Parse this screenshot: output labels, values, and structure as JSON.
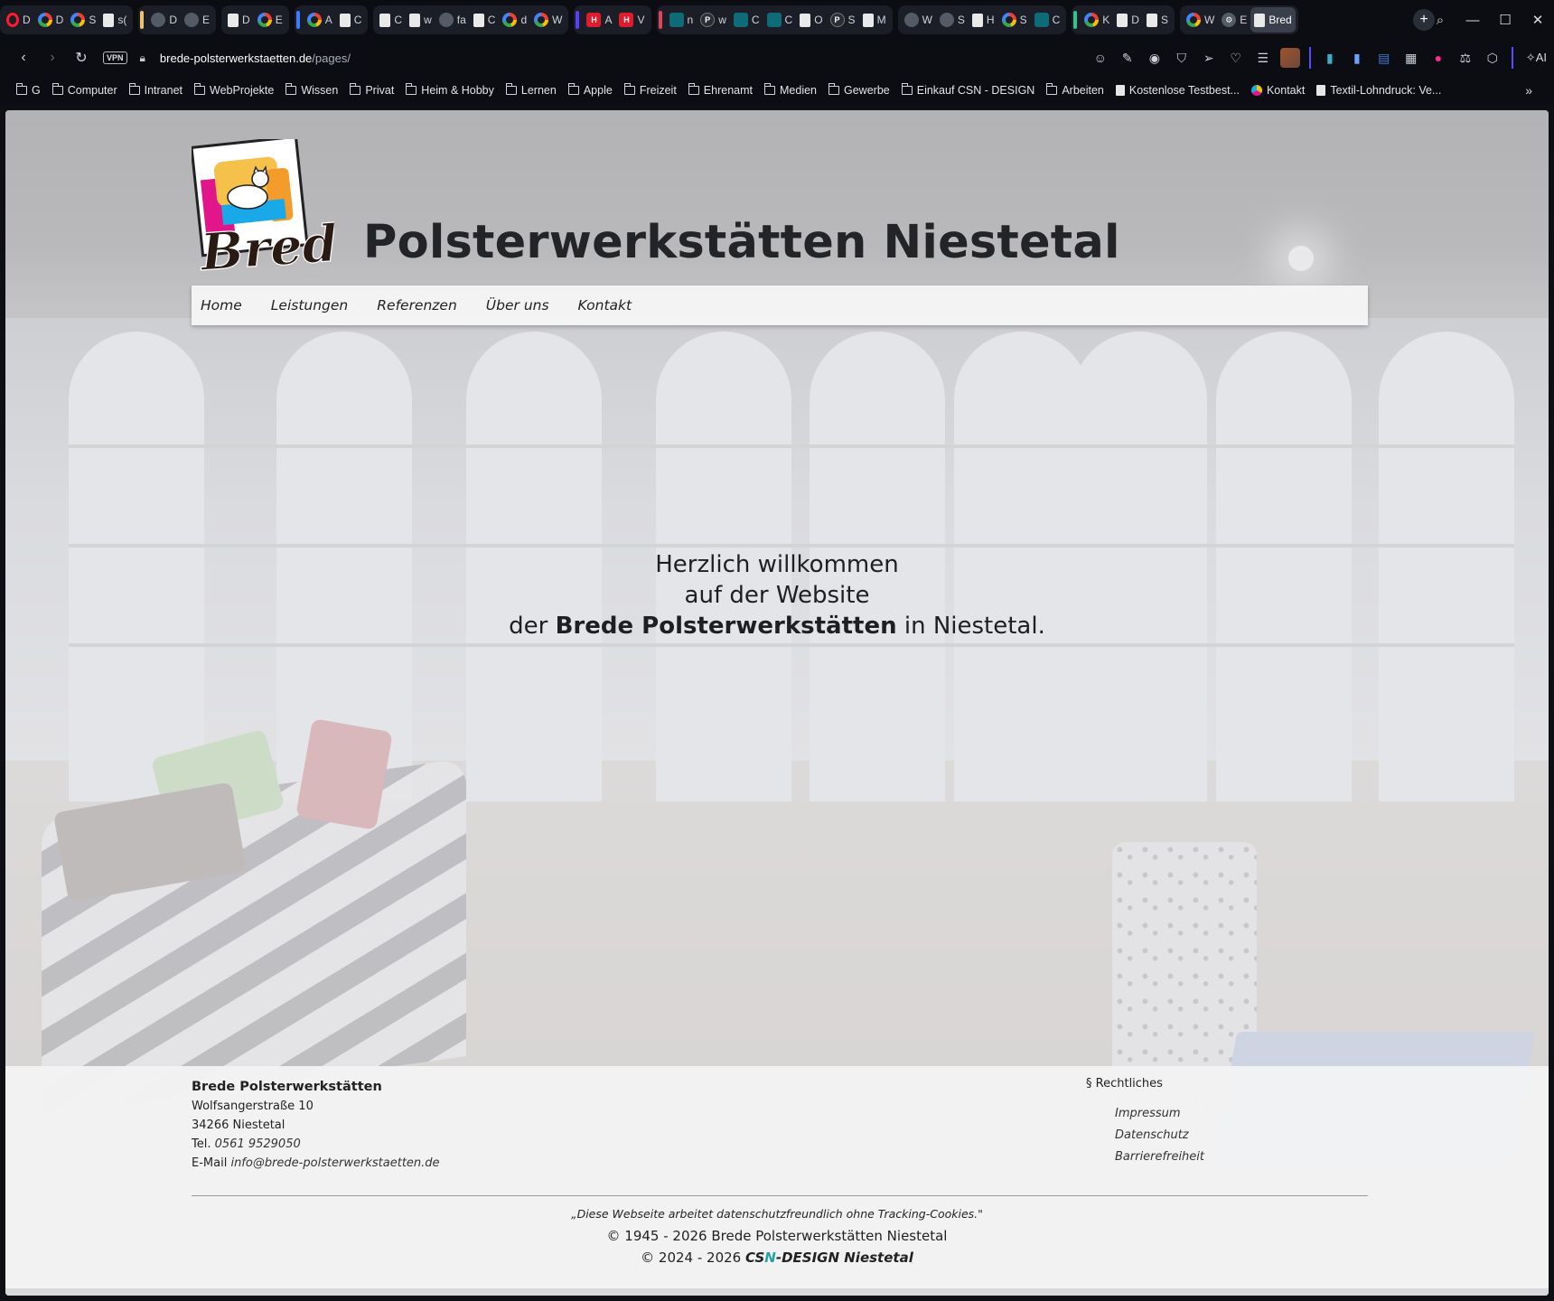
{
  "browser": {
    "tabs": [
      {
        "group_color": "",
        "items": [
          {
            "icon": "opera-icon",
            "label": "D"
          },
          {
            "icon": "google",
            "label": "D"
          },
          {
            "icon": "google",
            "label": "S"
          },
          {
            "icon": "doc",
            "label": "s("
          }
        ]
      },
      {
        "group_color": "#f0c36a",
        "items": [
          {
            "icon": "sun",
            "label": "D"
          },
          {
            "icon": "sun",
            "label": "E"
          }
        ]
      },
      {
        "group_color": "",
        "items": [
          {
            "icon": "doc",
            "label": "D"
          },
          {
            "icon": "google",
            "label": "E"
          }
        ]
      },
      {
        "group_color": "#3d7bff",
        "items": [
          {
            "icon": "google",
            "label": "A"
          },
          {
            "icon": "doc",
            "label": "C"
          }
        ]
      },
      {
        "group_color": "",
        "items": [
          {
            "icon": "doc",
            "label": "C"
          },
          {
            "icon": "doc",
            "label": "w"
          },
          {
            "icon": "grey",
            "label": "fa"
          },
          {
            "icon": "doc",
            "label": "C"
          },
          {
            "icon": "google",
            "label": "d"
          },
          {
            "icon": "google",
            "label": "W"
          }
        ]
      },
      {
        "group_color": "#5b3dff",
        "items": [
          {
            "icon": "red",
            "label": "A"
          },
          {
            "icon": "red",
            "label": "V"
          }
        ]
      },
      {
        "group_color": "#e0445a",
        "items": [
          {
            "icon": "teal",
            "label": "n"
          },
          {
            "icon": "dark",
            "label": "w"
          },
          {
            "icon": "teal",
            "label": "C"
          },
          {
            "icon": "teal",
            "label": "C"
          },
          {
            "icon": "doc",
            "label": "O"
          },
          {
            "icon": "dark",
            "label": "S"
          },
          {
            "icon": "doc",
            "label": "M"
          }
        ]
      },
      {
        "group_color": "",
        "items": [
          {
            "icon": "grey",
            "label": "W"
          },
          {
            "icon": "grey",
            "label": "S"
          },
          {
            "icon": "doc",
            "label": "H"
          },
          {
            "icon": "google",
            "label": "S"
          },
          {
            "icon": "teal",
            "label": "C"
          }
        ]
      },
      {
        "group_color": "#34c38f",
        "items": [
          {
            "icon": "google",
            "label": "K"
          },
          {
            "icon": "doc",
            "label": "D"
          },
          {
            "icon": "doc",
            "label": "S"
          }
        ]
      },
      {
        "group_color": "",
        "items": [
          {
            "icon": "google",
            "label": "W"
          },
          {
            "icon": "gear",
            "label": "E"
          },
          {
            "icon": "doc",
            "label": "Bred",
            "active": true
          }
        ]
      }
    ],
    "url_host": "brede-polsterwerkstaetten.de",
    "url_path": "/pages/",
    "vpn_label": "VPN",
    "ai_label": "AI",
    "bookmarks": [
      {
        "type": "folder",
        "label": "G"
      },
      {
        "type": "folder",
        "label": "Computer"
      },
      {
        "type": "folder",
        "label": "Intranet"
      },
      {
        "type": "folder",
        "label": "WebProjekte"
      },
      {
        "type": "folder",
        "label": "Wissen"
      },
      {
        "type": "folder",
        "label": "Privat"
      },
      {
        "type": "folder",
        "label": "Heim & Hobby"
      },
      {
        "type": "folder",
        "label": "Lernen"
      },
      {
        "type": "folder",
        "label": "Apple"
      },
      {
        "type": "folder",
        "label": "Freizeit"
      },
      {
        "type": "folder",
        "label": "Ehrenamt"
      },
      {
        "type": "folder",
        "label": "Medien"
      },
      {
        "type": "folder",
        "label": "Gewerbe"
      },
      {
        "type": "folder",
        "label": "Einkauf CSN - DESIGN"
      },
      {
        "type": "folder",
        "label": "Arbeiten"
      },
      {
        "type": "page",
        "label": "Kostenlose Testbest..."
      },
      {
        "type": "circle",
        "label": "Kontakt"
      },
      {
        "type": "page",
        "label": "Textil-Lohndruck: Ve..."
      }
    ]
  },
  "site": {
    "logo_text": "Brede",
    "title": "Polsterwerkstätten Niestetal",
    "nav": [
      "Home",
      "Leistungen",
      "Referenzen",
      "Über uns",
      "Kontakt"
    ],
    "welcome": {
      "line1": "Herzlich willkommen",
      "line2": "auf der Website",
      "line3_pre": "der",
      "line3_bold": "Brede Polsterwerkstätten",
      "line3_post": "in Niestetal."
    },
    "footer": {
      "company": "Brede Polsterwerkstätten",
      "street": "Wolfsangerstraße 10",
      "city": "34266 Niestetal",
      "tel_label": "Tel.",
      "tel": "0561 9529050",
      "email_label": "E-Mail",
      "email": "info@brede-polsterwerkstaetten.de",
      "legal_heading": "§ Rechtliches",
      "legal_links": [
        "Impressum",
        "Datenschutz",
        "Barrierefreiheit"
      ],
      "privacy_note": "„Diese Webseite arbeitet datenschutzfreundlich ohne Tracking-Cookies.\"",
      "copyright1": "© 1945 - 2026 Brede Polsterwerkstätten Niestetal",
      "copyright2_pre": "© 2024 - 2026",
      "designer_a": "CS",
      "designer_n": "N",
      "designer_b": "-DESIGN Niestetal"
    }
  },
  "colors": {
    "accent_teal": "#1fa3a3",
    "title_text": "#222428",
    "browser_bg": "#0b0d12"
  }
}
